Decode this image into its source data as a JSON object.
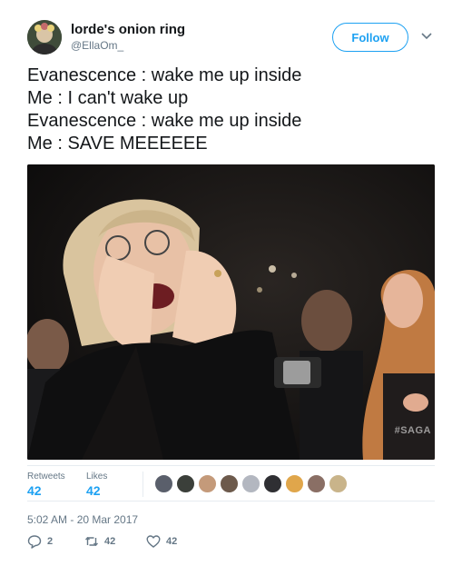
{
  "author": {
    "display_name": "lorde's onion ring",
    "handle": "@EllaOm_"
  },
  "follow_label": "Follow",
  "tweet_lines": [
    "Evanescence : wake me up inside",
    "Me : I can't wake up",
    "Evanescence : wake me up inside",
    "Me : SAVE MEEEEEE"
  ],
  "media": {
    "watermark": "#SAGA"
  },
  "stats": {
    "retweets_label": "Retweets",
    "retweets_count": "42",
    "likes_label": "Likes",
    "likes_count": "42"
  },
  "liker_colors": [
    "#5a5f6b",
    "#3b3f3a",
    "#c49a7a",
    "#6d5a4c",
    "#b3b7c0",
    "#2f2f33",
    "#e0a64b",
    "#8a6f65",
    "#c9b48a"
  ],
  "timestamp": "5:02 AM - 20 Mar 2017",
  "actions": {
    "reply_count": "2",
    "retweet_count": "42",
    "like_count": "42"
  },
  "colors": {
    "accent": "#1da1f2",
    "secondary_text": "#657786",
    "border": "#e6ecf0"
  },
  "icons": [
    "chevron-down-icon",
    "reply-icon",
    "retweet-icon",
    "heart-icon"
  ]
}
